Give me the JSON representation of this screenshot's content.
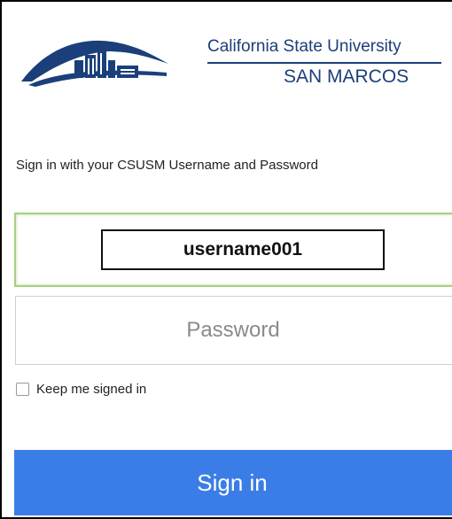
{
  "logo": {
    "line1": "California State University",
    "line2": "SAN MARCOS",
    "color": "#1b3f7a"
  },
  "form": {
    "instructions": "Sign in with your CSUSM Username and Password",
    "username_value": "username001",
    "password_placeholder": "Password",
    "keep_signed_in_label": "Keep me signed in",
    "keep_signed_in_checked": false,
    "sign_in_label": "Sign in"
  },
  "colors": {
    "accent": "#3b7de6",
    "focus_border": "#a6cf80",
    "brand": "#1b3f7a"
  }
}
